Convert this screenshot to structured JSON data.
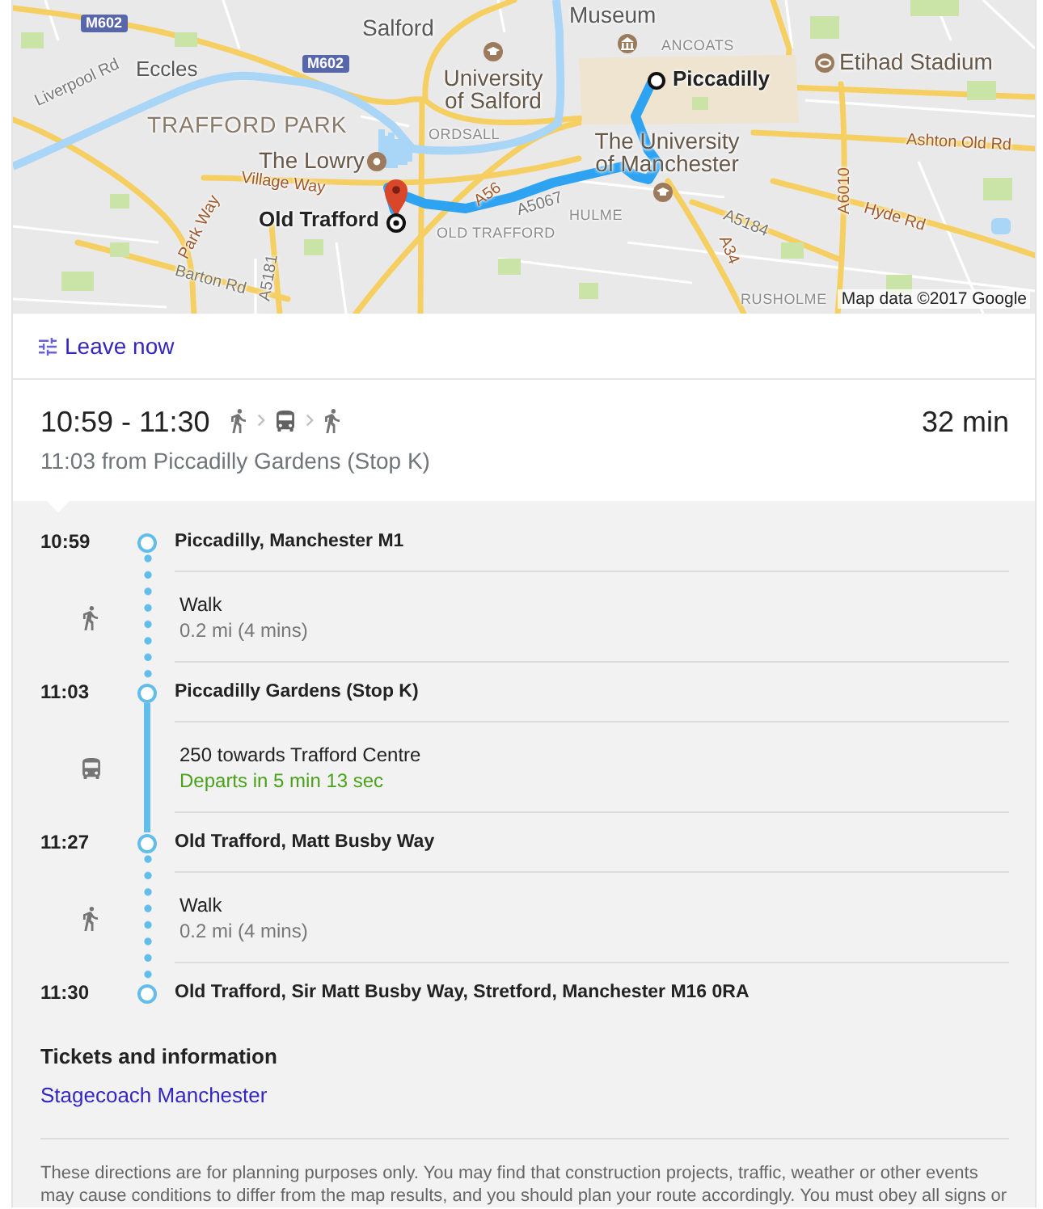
{
  "map": {
    "labels": [
      {
        "text": "M602",
        "kind": "shield"
      },
      {
        "text": "Salford",
        "kind": "place"
      },
      {
        "text": "Museum",
        "kind": "place"
      },
      {
        "text": "ANCOATS",
        "kind": "locality"
      },
      {
        "text": "Eccles",
        "kind": "place"
      },
      {
        "text": "M602",
        "kind": "shield"
      },
      {
        "text": "Etihad Stadium",
        "kind": "poi"
      },
      {
        "text": "Liverpool Rd",
        "kind": "street"
      },
      {
        "text": "University of Salford",
        "kind": "poi"
      },
      {
        "text": "Piccadilly",
        "kind": "endpoint"
      },
      {
        "text": "TRAFFORD PARK",
        "kind": "district"
      },
      {
        "text": "ORDSALL",
        "kind": "locality"
      },
      {
        "text": "The Lowry",
        "kind": "poi"
      },
      {
        "text": "The University of Manchester",
        "kind": "poi"
      },
      {
        "text": "Ashton Old Rd",
        "kind": "road"
      },
      {
        "text": "Village Way",
        "kind": "road"
      },
      {
        "text": "A56",
        "kind": "road"
      },
      {
        "text": "A5067",
        "kind": "street"
      },
      {
        "text": "A6010",
        "kind": "road"
      },
      {
        "text": "Park Way",
        "kind": "road"
      },
      {
        "text": "Old Trafford",
        "kind": "endpoint"
      },
      {
        "text": "HULME",
        "kind": "locality"
      },
      {
        "text": "OLD TRAFFORD",
        "kind": "locality"
      },
      {
        "text": "A5184",
        "kind": "street"
      },
      {
        "text": "Hyde Rd",
        "kind": "road"
      },
      {
        "text": "A34",
        "kind": "road"
      },
      {
        "text": "Barton Rd",
        "kind": "street"
      },
      {
        "text": "A5181",
        "kind": "street"
      },
      {
        "text": "RUSHOLME",
        "kind": "locality"
      }
    ],
    "attribution": "Map data ©2017 Google"
  },
  "departure": {
    "label": "Leave now"
  },
  "summary": {
    "time_range": "10:59 - 11:30",
    "modes": [
      {
        "kind": "walk"
      },
      {
        "kind": "bus"
      },
      {
        "kind": "walk"
      }
    ],
    "duration": "32 min",
    "subtitle": "11:03 from Piccadilly Gardens (Stop K)"
  },
  "itinerary": [
    {
      "kind": "stop",
      "time": "10:59",
      "name": "Piccadilly, Manchester M1"
    },
    {
      "kind": "walk",
      "title": "Walk",
      "detail": "0.2 mi (4 mins)"
    },
    {
      "kind": "stop",
      "time": "11:03",
      "name": "Piccadilly Gardens (Stop K)"
    },
    {
      "kind": "bus",
      "title": "250 towards Trafford Centre",
      "status": "Departs in 5 min 13 sec"
    },
    {
      "kind": "stop",
      "time": "11:27",
      "name": "Old Trafford, Matt Busby Way"
    },
    {
      "kind": "walk",
      "title": "Walk",
      "detail": "0.2 mi (4 mins)"
    },
    {
      "kind": "stop",
      "time": "11:30",
      "name": "Old Trafford, Sir Matt Busby Way, Stretford, Manchester M16 0RA"
    }
  ],
  "tickets": {
    "heading": "Tickets and information",
    "link": "Stagecoach Manchester"
  },
  "disclaimer": "These directions are for planning purposes only. You may find that construction projects, traffic, weather or other events may cause conditions to differ from the map results, and you should plan your route accordingly. You must obey all signs or"
}
